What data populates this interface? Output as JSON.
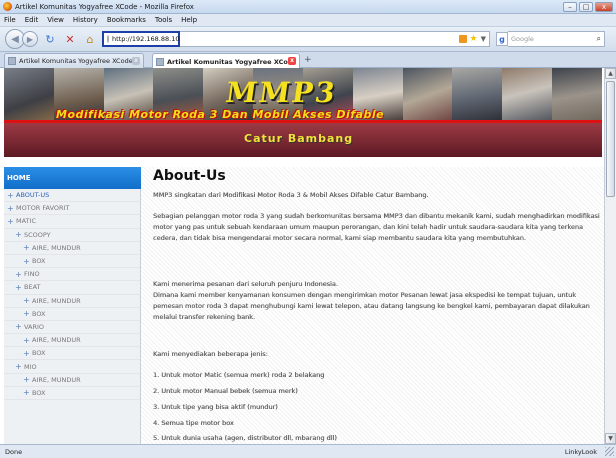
{
  "window": {
    "title": "Artikel Komunitas Yogyafree XCode - Mozilla Firefox",
    "buttons": [
      "–",
      "□",
      "x"
    ]
  },
  "menubar": [
    "File",
    "Edit",
    "View",
    "History",
    "Bookmarks",
    "Tools",
    "Help"
  ],
  "navbar": {
    "back_icon": "back-arrow-icon",
    "forward_icon": "forward-arrow-icon",
    "url": "http://192.168.88.100/",
    "search_placeholder": "Google",
    "search_engine_glyph": "g"
  },
  "tabs": [
    {
      "label": "Artikel Komunitas Yogyafree XCode",
      "active": false
    },
    {
      "label": "Artikel Komunitas Yogyafree XCo...",
      "active": true
    }
  ],
  "banner": {
    "logo": "MMP3",
    "tagline": "Modifikasi Motor Roda 3 Dan Mobil Akses Difable",
    "author": "Catur Bambang",
    "accent_color": "#d11111",
    "logo_color": "#f6e11e"
  },
  "sidebar": {
    "home": "HOME",
    "items": [
      {
        "label": "ABOUT-US",
        "level": 0,
        "plus": "+"
      },
      {
        "label": "MOTOR FAVORIT",
        "level": 0,
        "plus": "+"
      },
      {
        "label": "MATIC",
        "level": 0,
        "plus": "+"
      },
      {
        "label": "SCOOPY",
        "level": 1,
        "plus": "+"
      },
      {
        "label": "AIRE, MUNDUR",
        "level": 2,
        "plus": "+"
      },
      {
        "label": "BOX",
        "level": 2,
        "plus": "+"
      },
      {
        "label": "FINO",
        "level": 1,
        "plus": "+"
      },
      {
        "label": "BEAT",
        "level": 1,
        "plus": "+"
      },
      {
        "label": "AIRE, MUNDUR",
        "level": 2,
        "plus": "+"
      },
      {
        "label": "BOX",
        "level": 2,
        "plus": "+"
      },
      {
        "label": "VARIO",
        "level": 1,
        "plus": "+"
      },
      {
        "label": "AIRE, MUNDUR",
        "level": 2,
        "plus": "+"
      },
      {
        "label": "BOX",
        "level": 2,
        "plus": "+"
      },
      {
        "label": "MIO",
        "level": 1,
        "plus": "+"
      },
      {
        "label": "AIRE, MUNDUR",
        "level": 2,
        "plus": "+"
      },
      {
        "label": "BOX",
        "level": 2,
        "plus": "+"
      }
    ]
  },
  "article": {
    "title": "About-Us",
    "paragraphs": [
      "MMP3 singkatan dari Modifikasi Motor Roda 3 & Mobil Akses Difable Catur Bambang.",
      "Sebagian pelanggan motor roda 3 yang sudah berkomunitas bersama MMP3 dan dibantu mekanik kami, sudah menghadirkan modifikasi motor yang pas untuk sebuah kendaraan umum maupun perorangan, dan kini telah hadir untuk saudara-saudara kita yang terkena cedera, dan tidak bisa mengendarai motor secara normal, kami siap membantu saudara kita yang membutuhkan.",
      "Kami menerima pesanan dari seluruh penjuru Indonesia.",
      "Dimana kami member kenyamanan konsumen dengan mengirimkan motor Pesanan lewat jasa ekspedisi ke tempat tujuan, untuk pemesan motor roda 3 dapat menghubungi kami lewat telepon, atau datang langsung ke bengkel kami, pembayaran dapat dilakukan melalui transfer rekening bank.",
      "Kami menyediakan beberapa jenis:"
    ],
    "list": [
      "1. Untuk motor Matic (semua merk) roda 2 belakang",
      "2. Untuk motor Manual bebek (semua merk)",
      "3. Untuk tipe yang bisa aktif (mundur)",
      "4. Semua tipe motor box",
      "5. Untuk dunia usaha (agen, distributor dll, mbarang dll)"
    ]
  },
  "statusbar": {
    "status": "Done",
    "addon": "LinkyLook"
  }
}
